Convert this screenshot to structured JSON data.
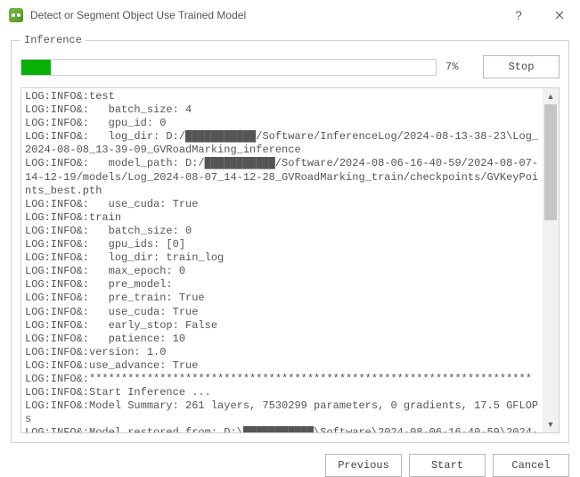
{
  "window": {
    "title": "Detect or Segment Object Use Trained Model"
  },
  "group": {
    "legend": "Inference"
  },
  "progress": {
    "percent_value": 7,
    "percent_text": "7%",
    "bar_color": "#06b006"
  },
  "buttons": {
    "stop": "Stop",
    "previous": "Previous",
    "start": "Start",
    "cancel": "Cancel"
  },
  "log_lines": [
    "LOG:INFO&:test",
    "LOG:INFO&:   batch_size: 4",
    "LOG:INFO&:   gpu_id: 0",
    "LOG:INFO&:   log_dir: D:/███████████/Software/InferenceLog/2024-08-13-38-23\\Log_2024-08-08_13-39-09_GVRoadMarking_inference",
    "LOG:INFO&:   model_path: D:/███████████/Software/2024-08-06-16-40-59/2024-08-07-14-12-19/models/Log_2024-08-07_14-12-28_GVRoadMarking_train/checkpoints/GVKeyPoints_best.pth",
    "LOG:INFO&:   use_cuda: True",
    "LOG:INFO&:train",
    "LOG:INFO&:   batch_size: 0",
    "LOG:INFO&:   gpu_ids: [0]",
    "LOG:INFO&:   log_dir: train_log",
    "LOG:INFO&:   max_epoch: 0",
    "LOG:INFO&:   pre_model:",
    "LOG:INFO&:   pre_train: True",
    "LOG:INFO&:   use_cuda: True",
    "LOG:INFO&:   early_stop: False",
    "LOG:INFO&:   patience: 10",
    "LOG:INFO&:version: 1.0",
    "LOG:INFO&:use_advance: True",
    "LOG:INFO&:*********************************************************************",
    "LOG:INFO&:Start Inference ...",
    "LOG:INFO&:Model Summary: 261 layers, 7530299 parameters, 0 gradients, 17.5 GFLOPs",
    "LOG:INFO&:Model restored from: D:\\███████████\\Software\\2024-08-06-16-40-59\\2024-08-07-14-12-19\\models\\Log_2024-08-07_14-12-28_GVRoadMarking_train\\checkpoints\\GVMarksObb_best.pth"
  ]
}
